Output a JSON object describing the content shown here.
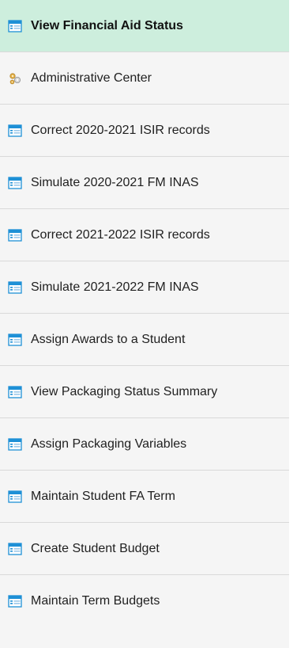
{
  "nav": {
    "items": [
      {
        "label": "View Financial Aid Status",
        "icon": "component-icon",
        "active": true
      },
      {
        "label": "Administrative Center",
        "icon": "gear-cluster-icon",
        "active": false
      },
      {
        "label": "Correct 2020-2021 ISIR records",
        "icon": "component-icon",
        "active": false
      },
      {
        "label": "Simulate 2020-2021 FM INAS",
        "icon": "component-icon",
        "active": false
      },
      {
        "label": "Correct 2021-2022 ISIR records",
        "icon": "component-icon",
        "active": false
      },
      {
        "label": "Simulate 2021-2022 FM INAS",
        "icon": "component-icon",
        "active": false
      },
      {
        "label": "Assign Awards to a Student",
        "icon": "component-icon",
        "active": false
      },
      {
        "label": "View Packaging Status Summary",
        "icon": "component-icon",
        "active": false
      },
      {
        "label": "Assign Packaging Variables",
        "icon": "component-icon",
        "active": false
      },
      {
        "label": "Maintain Student FA Term",
        "icon": "component-icon",
        "active": false
      },
      {
        "label": "Create Student Budget",
        "icon": "component-icon",
        "active": false
      },
      {
        "label": "Maintain Term Budgets",
        "icon": "component-icon",
        "active": false
      }
    ]
  },
  "colors": {
    "active_bg": "#cdeedd",
    "item_bg": "#f5f5f5",
    "divider": "#d9d9d9",
    "icon_blue": "#1e90d6"
  }
}
